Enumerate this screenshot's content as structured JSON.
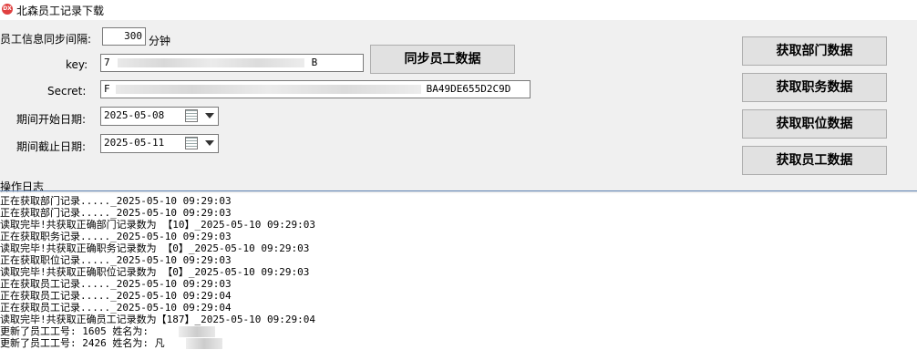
{
  "window": {
    "title": "北森员工记录下载",
    "icon_text": "DX"
  },
  "form": {
    "interval_label": "员工信息同步间隔:",
    "interval_value": "300",
    "interval_unit": "分钟",
    "key_label": "key:",
    "key_start": "7",
    "key_end": "B",
    "secret_label": "Secret:",
    "secret_start": "F",
    "secret_end": "BA49DE655D2C9D",
    "start_date_label": "期间开始日期:",
    "start_date": "2025-05-08",
    "end_date_label": "期间截止日期:",
    "end_date": "2025-05-11"
  },
  "buttons": {
    "sync_employee": "同步员工数据",
    "get_department": "获取部门数据",
    "get_duty": "获取职务数据",
    "get_position": "获取职位数据",
    "get_employee": "获取员工数据"
  },
  "log": {
    "title": "操作日志",
    "lines": [
      "正在获取部门记录....._2025-05-10 09:29:03",
      "正在获取部门记录....._2025-05-10 09:29:03",
      "读取完毕!共获取正确部门记录数为 【10】_2025-05-10 09:29:03",
      "正在获取职务记录....._2025-05-10 09:29:03",
      "读取完毕!共获取正确职务记录数为 【0】_2025-05-10 09:29:03",
      "正在获取职位记录....._2025-05-10 09:29:03",
      "读取完毕!共获取正确职位记录数为 【0】_2025-05-10 09:29:03",
      "正在获取员工记录....._2025-05-10 09:29:03",
      "正在获取员工记录....._2025-05-10 09:29:04",
      "正在获取员工记录....._2025-05-10 09:29:04",
      "读取完毕!共获取正确员工记录数为【187】_2025-05-10 09:29:04",
      "更新了员工工号: 1605  姓名为:",
      "更新了员工工号: 2426  姓名为: 凡"
    ]
  },
  "colors": {
    "accent": "#5a7fb0",
    "button_bg": "#e1e1e1"
  }
}
